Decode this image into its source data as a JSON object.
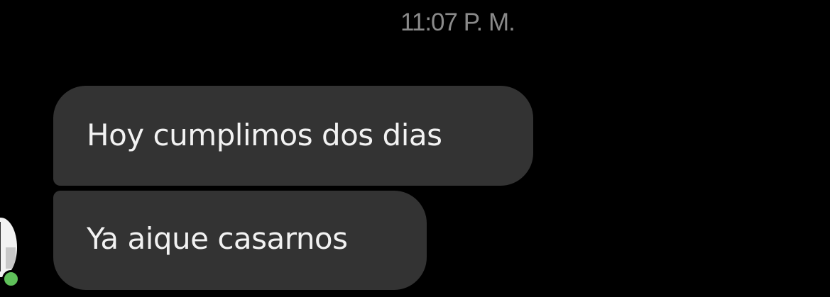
{
  "conversation": {
    "timestamp": "11:07 P. M.",
    "messages": [
      {
        "text": "Hoy cumplimos dos dias"
      },
      {
        "text": "Ya aique casarnos"
      }
    ]
  },
  "sender": {
    "status": "online"
  },
  "colors": {
    "background": "#000000",
    "bubble": "#333333",
    "text": "#f2f2f2",
    "timestamp": "#8a8a8a",
    "online_indicator": "#5fc15a"
  }
}
